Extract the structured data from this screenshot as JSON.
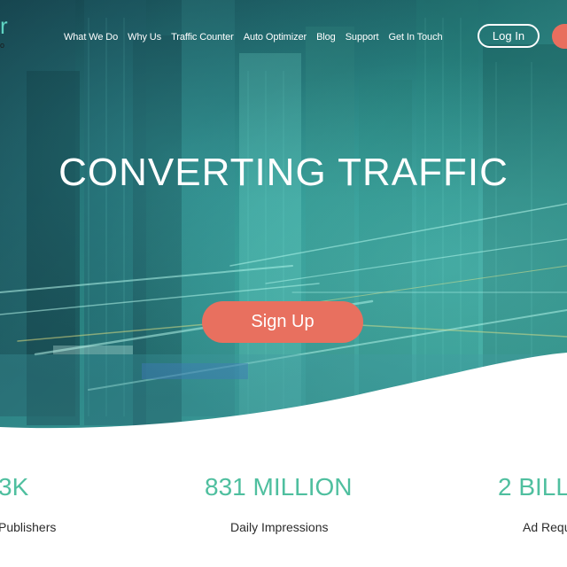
{
  "header": {
    "logo_fragment": "r",
    "logo_sub_fragment": "o",
    "nav": [
      "What We Do",
      "Why Us",
      "Traffic Counter",
      "Auto Optimizer",
      "Blog",
      "Support",
      "Get In Touch"
    ],
    "login_label": "Log In"
  },
  "hero": {
    "headline": "CONVERTING TRAFFIC",
    "cta_label": "Sign Up"
  },
  "stats": [
    {
      "value": "3K",
      "label": "Publishers"
    },
    {
      "value": "831 MILLION",
      "label": "Daily Impressions"
    },
    {
      "value": "2 BILL",
      "label": "Ad Requ"
    }
  ],
  "colors": {
    "accent_teal": "#4fbf9f",
    "cta_coral": "#e8705f",
    "hero_teal": "#2a8a86"
  }
}
